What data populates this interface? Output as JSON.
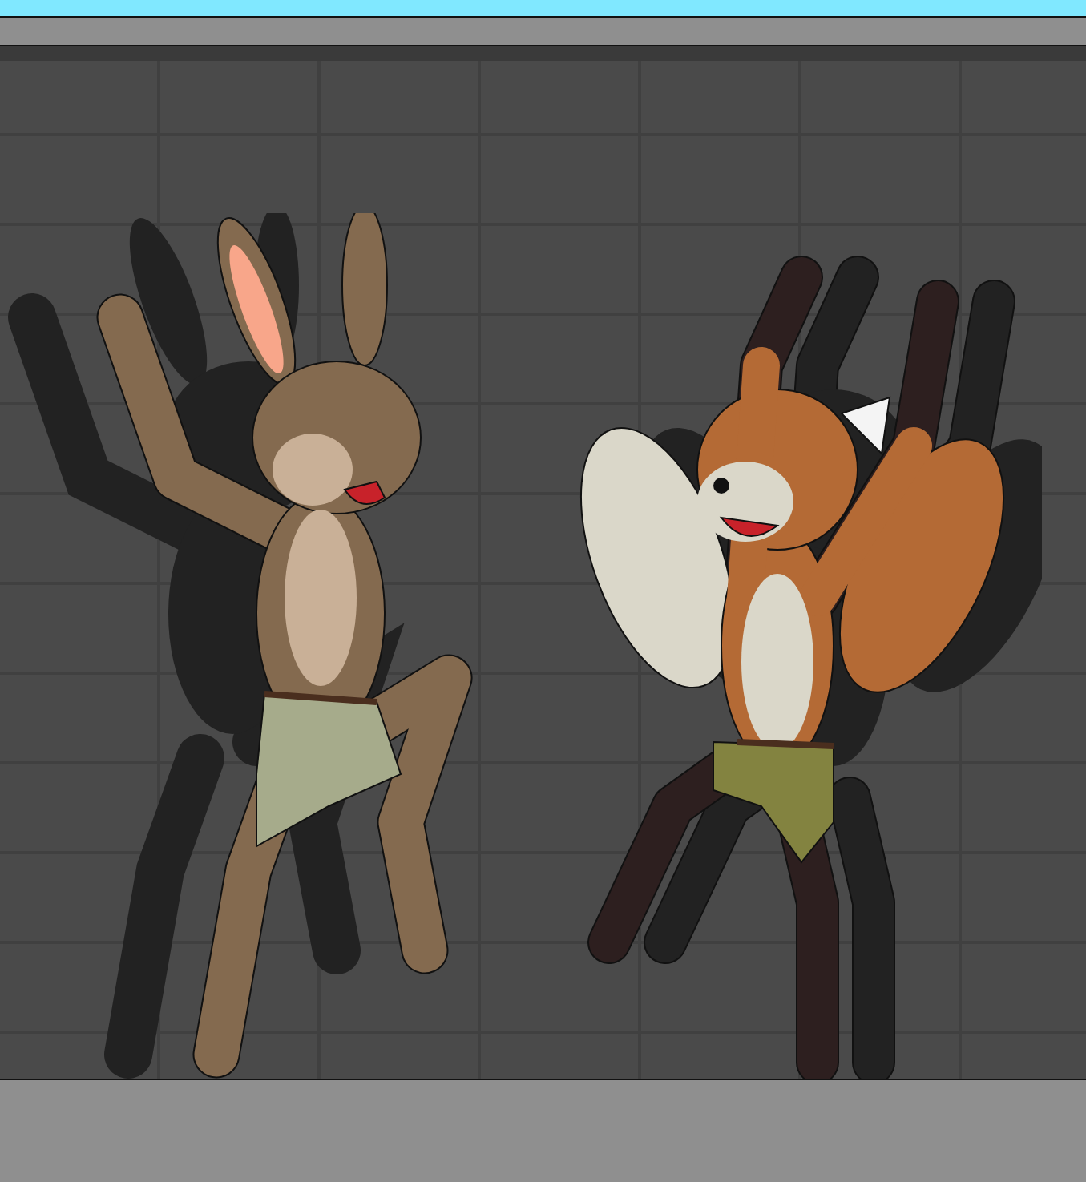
{
  "scene": {
    "characters": [
      {
        "kind": "hare"
      },
      {
        "kind": "fox"
      }
    ]
  }
}
